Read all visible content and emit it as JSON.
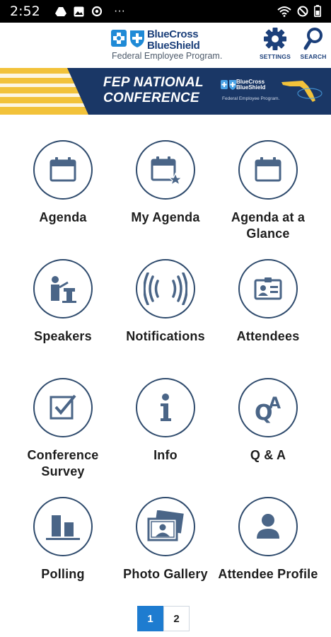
{
  "status_bar": {
    "time": "2:52",
    "more": "···"
  },
  "header": {
    "logo_line1": "BlueCross",
    "logo_line2": "BlueShield",
    "logo_subtitle": "Federal Employee Program.",
    "settings_label": "SETTINGS",
    "search_label": "SEARCH"
  },
  "banner": {
    "title_line1": "FEP NATIONAL",
    "title_line2": "CONFERENCE",
    "logo_line1": "BlueCross",
    "logo_line2": "BlueShield",
    "logo_subtitle": "Federal Employee Program."
  },
  "tiles": [
    {
      "label": "Agenda",
      "icon": "calendar-icon"
    },
    {
      "label": "My Agenda",
      "icon": "calendar-star-icon"
    },
    {
      "label": "Agenda at a Glance",
      "icon": "calendar-icon"
    },
    {
      "label": "Speakers",
      "icon": "speaker-podium-icon"
    },
    {
      "label": "Notifications",
      "icon": "broadcast-icon"
    },
    {
      "label": "Attendees",
      "icon": "badge-icon"
    },
    {
      "label": "Conference Survey",
      "icon": "checkbox-icon"
    },
    {
      "label": "Info",
      "icon": "info-icon"
    },
    {
      "label": "Q & A",
      "icon": "qa-icon"
    },
    {
      "label": "Polling",
      "icon": "bar-chart-icon"
    },
    {
      "label": "Photo Gallery",
      "icon": "photo-gallery-icon"
    },
    {
      "label": "Attendee Profile",
      "icon": "person-icon"
    }
  ],
  "pagination": {
    "pages": [
      "1",
      "2"
    ],
    "current": "1"
  },
  "colors": {
    "brand_navy": "#1b3f7a",
    "icon_stroke": "#2f4b6d",
    "icon_fill": "#4a6587",
    "banner_bg": "#1a3766",
    "banner_gold": "#f2c23a",
    "page_active": "#1e7cd0"
  }
}
